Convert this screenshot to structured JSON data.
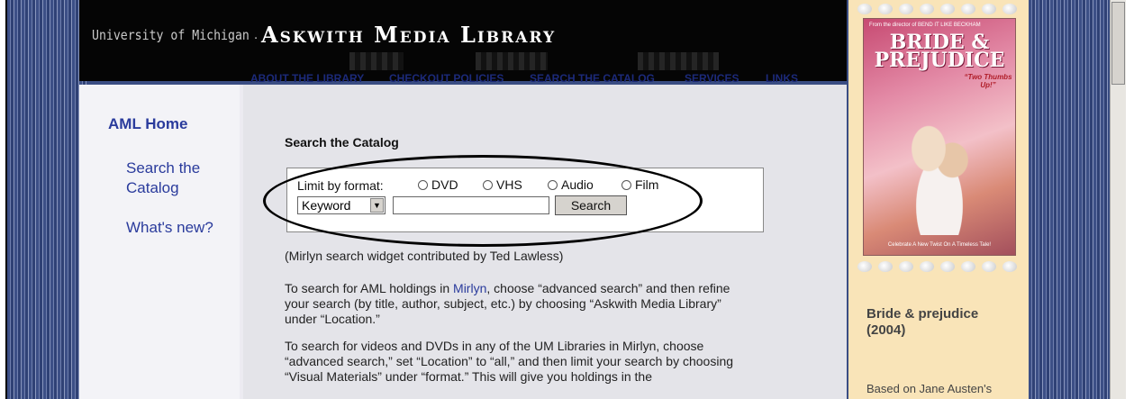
{
  "header": {
    "university": "University of Michigan",
    "separator": ".",
    "library_name": "Askwith Media Library"
  },
  "nav": {
    "items": [
      "ABOUT THE LIBRARY",
      "CHECKOUT POLICIES",
      "SEARCH THE CATALOG",
      "SERVICES",
      "LINKS"
    ]
  },
  "sidebar": {
    "home": "AML Home",
    "links": [
      "Search the Catalog",
      "What's new?"
    ]
  },
  "search": {
    "title": "Search the Catalog",
    "limit_label": "Limit by format:",
    "formats": [
      "DVD",
      "VHS",
      "Audio",
      "Film"
    ],
    "field_selected": "Keyword",
    "query_value": "",
    "button_label": "Search"
  },
  "content": {
    "credit": "(Mirlyn search widget contributed by Ted Lawless)",
    "para1_before": "To search for AML holdings in ",
    "para1_link": "Mirlyn",
    "para1_after": ", choose “advanced search” and then refine your search (by title, author, subject, etc.) by choosing “Askwith Media Library” under “Location.”",
    "para2": "To search for videos and DVDs in any of the UM Libraries in Mirlyn, choose “advanced search,” set “Location” to “all,” and then limit your search by choosing “Visual Materials” under “format.” This will give you holdings in the"
  },
  "featured": {
    "poster_tag": "From the director of BEND IT LIKE BECKHAM",
    "poster_title": "BRIDE & PREJUDICE",
    "poster_quote": "“Two Thumbs Up!”",
    "poster_tagline": "Celebrate A New Twist On A Timeless Tale!",
    "title": "Bride & prejudice (2004)",
    "description_start": "Based on Jane Austen's"
  },
  "colors": {
    "nav_text": "#1c2a7a",
    "link": "#2a3b9c",
    "side_band": "#3a4d83",
    "right_panel": "#f9e4b8",
    "header_bg": "#050505"
  }
}
